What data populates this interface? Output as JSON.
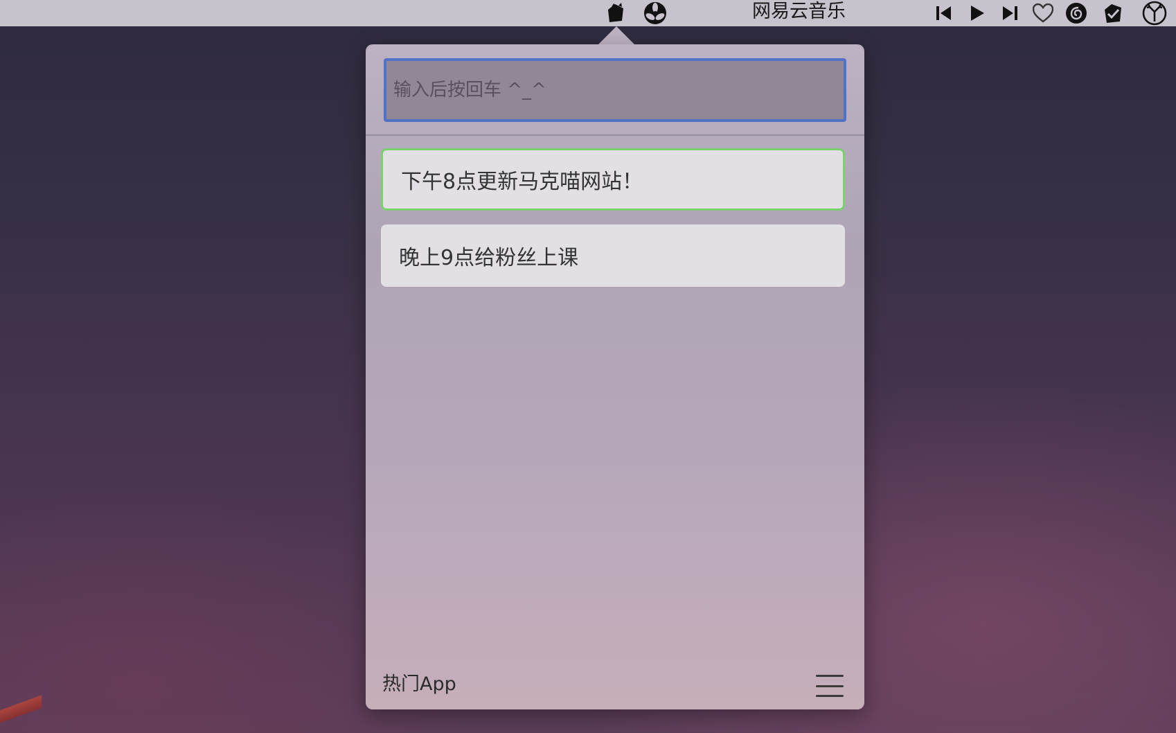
{
  "menubar": {
    "now_playing_title": "网易云音乐",
    "icons": [
      {
        "name": "reminder-app-icon"
      },
      {
        "name": "fan-app-icon"
      },
      {
        "name": "previous-track-icon"
      },
      {
        "name": "play-icon"
      },
      {
        "name": "next-track-icon"
      },
      {
        "name": "heart-icon"
      },
      {
        "name": "netease-music-icon"
      },
      {
        "name": "checkmark-app-icon"
      },
      {
        "name": "deer-app-icon"
      }
    ]
  },
  "popover": {
    "input": {
      "value": "",
      "placeholder": "输入后按回车 ^_^"
    },
    "tasks": [
      {
        "label": "下午8点更新马克喵网站！",
        "selected": true
      },
      {
        "label": "晚上9点给粉丝上课",
        "selected": false
      }
    ],
    "footer": {
      "hot_apps_label": "热门App",
      "menu_icon": "hamburger-menu-icon"
    }
  },
  "colors": {
    "input_border": "#5471c8",
    "selected_border": "#79d06c",
    "task_background": "#e3e0e5",
    "menubar_background": "#c8c2cc"
  }
}
